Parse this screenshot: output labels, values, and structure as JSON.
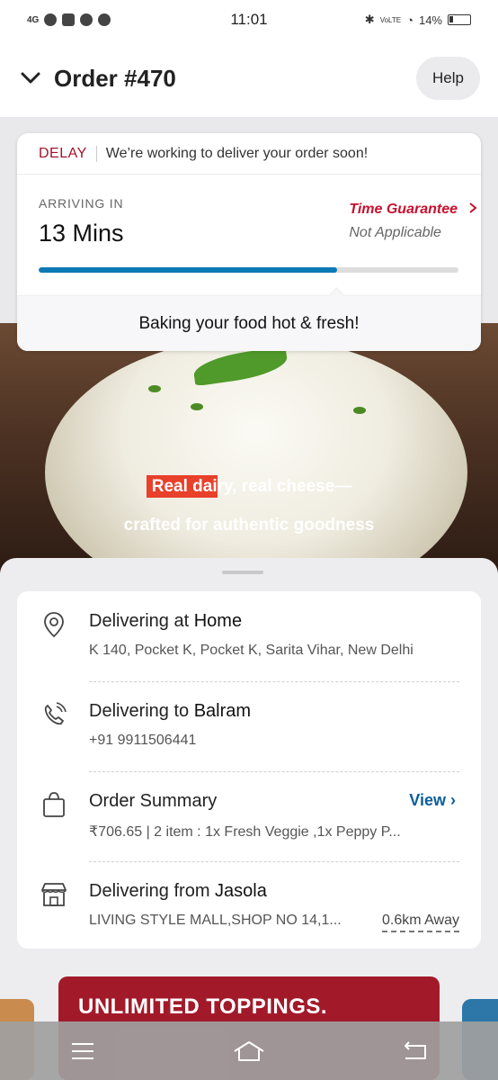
{
  "status_bar": {
    "network": "4G",
    "time": "11:01",
    "volte": "VoLTE",
    "battery": "14%"
  },
  "header": {
    "title": "Order #470",
    "help_label": "Help"
  },
  "status_card": {
    "delay_tag": "DELAY",
    "delay_message": "We’re working to deliver your order soon!",
    "arriving_label": "ARRIVING IN",
    "arriving_value": "13 Mins",
    "time_guarantee_title": "Time Guarantee",
    "time_guarantee_status": "Not Applicable",
    "progress_fraction": 0.71,
    "stage_text": "Baking your food hot & fresh!"
  },
  "hero": {
    "line1_highlight": "Real dai",
    "line1_rest": "ry, real cheese—",
    "line2": "crafted for authentic goodness"
  },
  "details": {
    "home": {
      "prefix": "Delivering at ",
      "name": "Home",
      "address": "K 140, Pocket K, Pocket K, Sarita Vihar, New Delhi"
    },
    "recipient": {
      "prefix": "Delivering to ",
      "name": "Balram",
      "phone": "+91 9911506441"
    },
    "summary": {
      "title": "Order Summary",
      "view_label": "View",
      "text": "₹706.65 | 2 item : 1x Fresh Veggie ,1x Peppy P..."
    },
    "store": {
      "prefix": "Delivering from ",
      "name": "Jasola",
      "address": "LIVING STYLE MALL,SHOP NO 14,1...",
      "distance": "0.6km Away"
    }
  },
  "promo": {
    "text": "UNLIMITED TOPPINGS."
  },
  "colors": {
    "accent_red": "#c8102e",
    "link_blue": "#0b5e9c",
    "progress_blue": "#0b7ab5"
  }
}
